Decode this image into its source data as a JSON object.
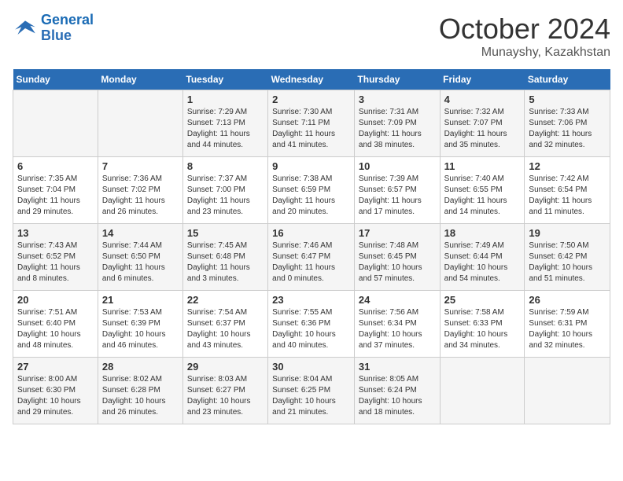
{
  "header": {
    "logo_line1": "General",
    "logo_line2": "Blue",
    "month": "October 2024",
    "location": "Munayshy, Kazakhstan"
  },
  "days_of_week": [
    "Sunday",
    "Monday",
    "Tuesday",
    "Wednesday",
    "Thursday",
    "Friday",
    "Saturday"
  ],
  "weeks": [
    [
      {
        "num": "",
        "info": ""
      },
      {
        "num": "",
        "info": ""
      },
      {
        "num": "1",
        "info": "Sunrise: 7:29 AM\nSunset: 7:13 PM\nDaylight: 11 hours and 44 minutes."
      },
      {
        "num": "2",
        "info": "Sunrise: 7:30 AM\nSunset: 7:11 PM\nDaylight: 11 hours and 41 minutes."
      },
      {
        "num": "3",
        "info": "Sunrise: 7:31 AM\nSunset: 7:09 PM\nDaylight: 11 hours and 38 minutes."
      },
      {
        "num": "4",
        "info": "Sunrise: 7:32 AM\nSunset: 7:07 PM\nDaylight: 11 hours and 35 minutes."
      },
      {
        "num": "5",
        "info": "Sunrise: 7:33 AM\nSunset: 7:06 PM\nDaylight: 11 hours and 32 minutes."
      }
    ],
    [
      {
        "num": "6",
        "info": "Sunrise: 7:35 AM\nSunset: 7:04 PM\nDaylight: 11 hours and 29 minutes."
      },
      {
        "num": "7",
        "info": "Sunrise: 7:36 AM\nSunset: 7:02 PM\nDaylight: 11 hours and 26 minutes."
      },
      {
        "num": "8",
        "info": "Sunrise: 7:37 AM\nSunset: 7:00 PM\nDaylight: 11 hours and 23 minutes."
      },
      {
        "num": "9",
        "info": "Sunrise: 7:38 AM\nSunset: 6:59 PM\nDaylight: 11 hours and 20 minutes."
      },
      {
        "num": "10",
        "info": "Sunrise: 7:39 AM\nSunset: 6:57 PM\nDaylight: 11 hours and 17 minutes."
      },
      {
        "num": "11",
        "info": "Sunrise: 7:40 AM\nSunset: 6:55 PM\nDaylight: 11 hours and 14 minutes."
      },
      {
        "num": "12",
        "info": "Sunrise: 7:42 AM\nSunset: 6:54 PM\nDaylight: 11 hours and 11 minutes."
      }
    ],
    [
      {
        "num": "13",
        "info": "Sunrise: 7:43 AM\nSunset: 6:52 PM\nDaylight: 11 hours and 8 minutes."
      },
      {
        "num": "14",
        "info": "Sunrise: 7:44 AM\nSunset: 6:50 PM\nDaylight: 11 hours and 6 minutes."
      },
      {
        "num": "15",
        "info": "Sunrise: 7:45 AM\nSunset: 6:48 PM\nDaylight: 11 hours and 3 minutes."
      },
      {
        "num": "16",
        "info": "Sunrise: 7:46 AM\nSunset: 6:47 PM\nDaylight: 11 hours and 0 minutes."
      },
      {
        "num": "17",
        "info": "Sunrise: 7:48 AM\nSunset: 6:45 PM\nDaylight: 10 hours and 57 minutes."
      },
      {
        "num": "18",
        "info": "Sunrise: 7:49 AM\nSunset: 6:44 PM\nDaylight: 10 hours and 54 minutes."
      },
      {
        "num": "19",
        "info": "Sunrise: 7:50 AM\nSunset: 6:42 PM\nDaylight: 10 hours and 51 minutes."
      }
    ],
    [
      {
        "num": "20",
        "info": "Sunrise: 7:51 AM\nSunset: 6:40 PM\nDaylight: 10 hours and 48 minutes."
      },
      {
        "num": "21",
        "info": "Sunrise: 7:53 AM\nSunset: 6:39 PM\nDaylight: 10 hours and 46 minutes."
      },
      {
        "num": "22",
        "info": "Sunrise: 7:54 AM\nSunset: 6:37 PM\nDaylight: 10 hours and 43 minutes."
      },
      {
        "num": "23",
        "info": "Sunrise: 7:55 AM\nSunset: 6:36 PM\nDaylight: 10 hours and 40 minutes."
      },
      {
        "num": "24",
        "info": "Sunrise: 7:56 AM\nSunset: 6:34 PM\nDaylight: 10 hours and 37 minutes."
      },
      {
        "num": "25",
        "info": "Sunrise: 7:58 AM\nSunset: 6:33 PM\nDaylight: 10 hours and 34 minutes."
      },
      {
        "num": "26",
        "info": "Sunrise: 7:59 AM\nSunset: 6:31 PM\nDaylight: 10 hours and 32 minutes."
      }
    ],
    [
      {
        "num": "27",
        "info": "Sunrise: 8:00 AM\nSunset: 6:30 PM\nDaylight: 10 hours and 29 minutes."
      },
      {
        "num": "28",
        "info": "Sunrise: 8:02 AM\nSunset: 6:28 PM\nDaylight: 10 hours and 26 minutes."
      },
      {
        "num": "29",
        "info": "Sunrise: 8:03 AM\nSunset: 6:27 PM\nDaylight: 10 hours and 23 minutes."
      },
      {
        "num": "30",
        "info": "Sunrise: 8:04 AM\nSunset: 6:25 PM\nDaylight: 10 hours and 21 minutes."
      },
      {
        "num": "31",
        "info": "Sunrise: 8:05 AM\nSunset: 6:24 PM\nDaylight: 10 hours and 18 minutes."
      },
      {
        "num": "",
        "info": ""
      },
      {
        "num": "",
        "info": ""
      }
    ]
  ]
}
